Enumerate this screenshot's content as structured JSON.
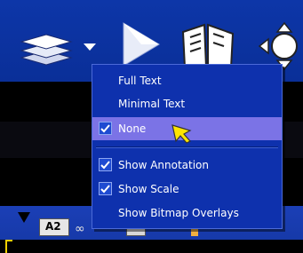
{
  "menu": {
    "items": [
      {
        "label": "Full Text",
        "checked": false
      },
      {
        "label": "Minimal Text",
        "checked": false
      },
      {
        "label": "None",
        "checked": true,
        "selected": true
      },
      {
        "label": "Show Annotation",
        "checked": true
      },
      {
        "label": "Show Scale",
        "checked": true
      },
      {
        "label": "Show Bitmap Overlays",
        "checked": false
      }
    ]
  },
  "bottom_bar": {
    "page_indicator": "A2"
  },
  "colors": {
    "toolbar_bg": "#0d36a8",
    "menu_bg": "#0e31ad",
    "selected_bg": "#7b73e6",
    "cursor": "#ffe400"
  },
  "icons": [
    "layers-icon",
    "dropdown-arrow-icon",
    "play-icon",
    "book-icon",
    "navigation-pad-icon",
    "mouse-cursor-icon"
  ]
}
